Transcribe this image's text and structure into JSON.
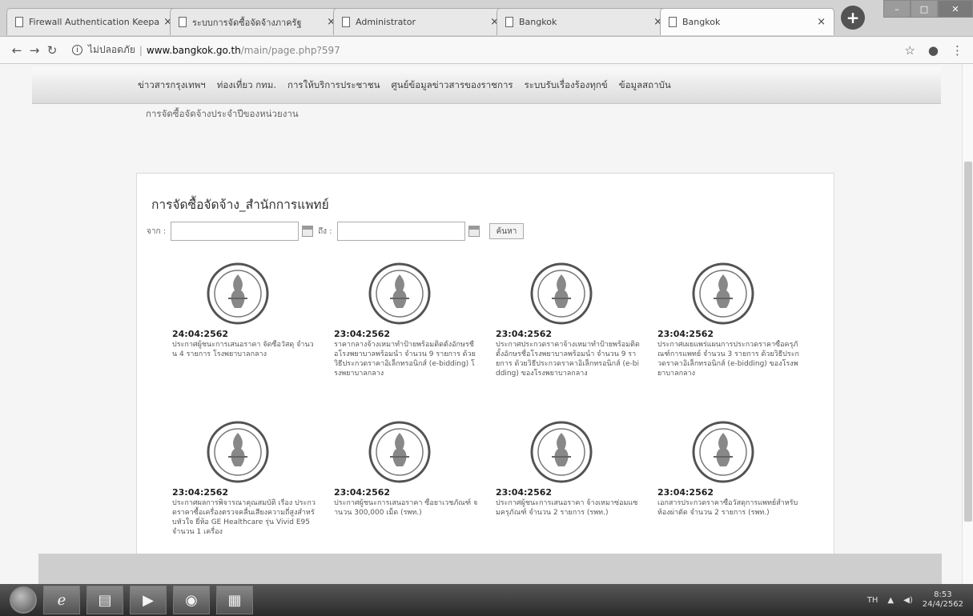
{
  "browser": {
    "tabs": [
      {
        "title": "Firewall Authentication Keepali",
        "active": false
      },
      {
        "title": "ระบบการจัดซื้อจัดจ้างภาครัฐ",
        "active": false
      },
      {
        "title": "Administrator",
        "active": false
      },
      {
        "title": "Bangkok",
        "active": false
      },
      {
        "title": "Bangkok",
        "active": true
      }
    ],
    "tab_close": "×",
    "new_tab_icon": "+",
    "address": {
      "security_label": "ไม่ปลอดภัย",
      "domain": "www.bangkok.go.th",
      "path": "/main/page.php?597"
    },
    "window_controls": {
      "minimize": "–",
      "maximize": "□",
      "close": "✕"
    }
  },
  "site": {
    "nav_items": [
      "ข่าวสารกรุงเทพฯ",
      "ท่องเที่ยว กทม.",
      "การให้บริการประชาชน",
      "ศูนย์ข้อมูลข่าวสารของราชการ",
      "ระบบรับเรื่องร้องทุกข์",
      "ข้อมูลสถาบัน"
    ],
    "sub_heading": "การจัดซื้อจัดจ้างประจำปีของหน่วยงาน"
  },
  "panel": {
    "title": "การจัดซื้อจัดจ้าง_สำนักการแพทย์",
    "search": {
      "from_label": "จาก :",
      "to_label": "ถึง :",
      "from_value": "",
      "to_value": "",
      "button_label": "ค้นหา"
    },
    "items": [
      {
        "date": "24:04:2562",
        "text": "ประกาศผู้ชนะการเสนอราคา จัดซื้อวัสดุ จำนวน 4 รายการ โรงพยาบาลกลาง"
      },
      {
        "date": "23:04:2562",
        "text": "ราคากลางจ้างเหมาทำป้ายพร้อมติดตั้งอักษรชื่อโรงพยาบาลพร้อมนำ จำนวน 9 รายการ ด้วยวิธีประกวดราคาอิเล็กทรอนิกส์ (e-bidding) โรงพยาบาลกลาง"
      },
      {
        "date": "23:04:2562",
        "text": "ประกาศประกวดราคาจ้างเหมาทำป้ายพร้อมติดตั้งอักษรชื่อโรงพยาบาลพร้อมนำ จำนวน 9 รายการ ด้วยวิธีประกวดราคาอิเล็กทรอนิกส์ (e-bidding) ของโรงพยาบาลกลาง"
      },
      {
        "date": "23:04:2562",
        "text": "ประกาศเผยแพร่แผนการประกวดราคาซื้อครุภัณฑ์การแพทย์ จำนวน 3 รายการ ด้วยวิธีประกวดราคาอิเล็กทรอนิกส์ (e-bidding) ของโรงพยาบาลกลาง"
      },
      {
        "date": "23:04:2562",
        "text": "ประกาศผลการพิจารณาคุณสมบัติ เรื่อง ประกวดราคาซื้อเครื่องตรวจคลื่นเสียงความถี่สูงสำหรับหัวใจ ยี่ห้อ GE Healthcare รุ่น Vivid E95 จำนวน 1 เครื่อง"
      },
      {
        "date": "23:04:2562",
        "text": "ประกาศผู้ชนะการเสนอราคา ซื้อยาเวชภัณฑ์ จำนวน 300,000 เม็ด (รพท.)"
      },
      {
        "date": "23:04:2562",
        "text": "ประกาศผู้ชนะการเสนอราคา จ้างเหมาซ่อมแซมครุภัณฑ์ จำนวน 2 รายการ (รพท.)"
      },
      {
        "date": "23:04:2562",
        "text": "เอกสารประกวดราคาซื้อวัสดุการแพทย์สำหรับห้องผ่าตัด จำนวน 2 รายการ (รพท.)"
      }
    ]
  },
  "taskbar": {
    "apps": [
      "ℯ",
      "▤",
      "▶",
      "◉",
      "▦"
    ],
    "tray_lang": "TH",
    "time": "8:53",
    "date": "24/4/2562"
  },
  "colors": {
    "page_bg": "#efefef",
    "panel_bg": "#ffffff",
    "taskbar": "#3a3a3a"
  }
}
